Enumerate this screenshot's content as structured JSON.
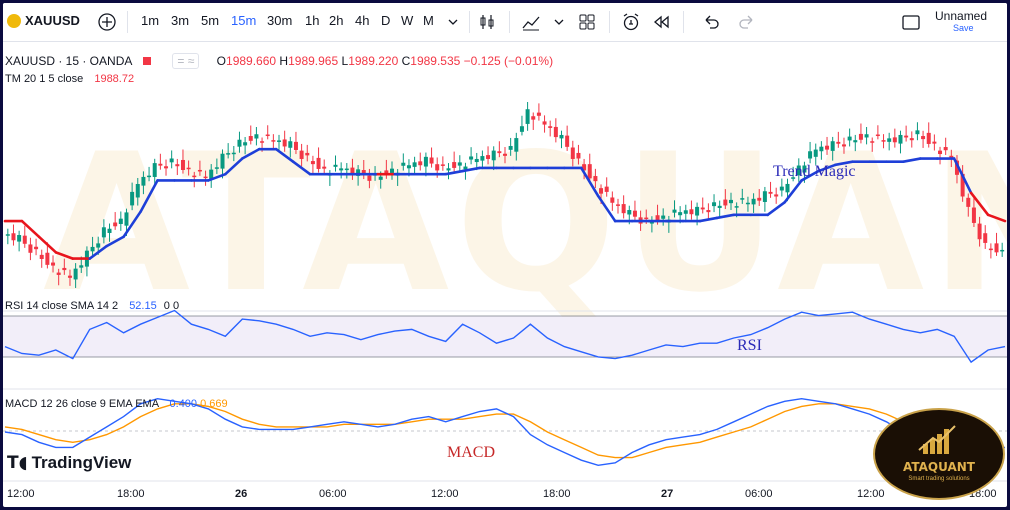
{
  "toolbar": {
    "symbol": "XAUUSD",
    "timeframes": [
      "1m",
      "3m",
      "5m",
      "15m",
      "30m",
      "1h",
      "2h",
      "4h",
      "D",
      "W",
      "M"
    ],
    "active_timeframe": "15m",
    "layout_name": "Unnamed",
    "save_label": "Save"
  },
  "legend": {
    "title": "XAUUSD · 15 · OANDA",
    "open_label": "O",
    "open": "1989.660",
    "high_label": "H",
    "high": "1989.965",
    "low_label": "L",
    "low": "1989.220",
    "close_label": "C",
    "close": "1989.535",
    "change": "−0.125 (−0.01%)",
    "tm_label": "TM 20 1 5 close",
    "tm_value": "1988.72",
    "rsi_label": "RSI 14 close SMA 14 2",
    "rsi_value": "52.15",
    "rsi_extra": "0 0",
    "macd_label": "MACD 12 26 close 9 EMA EMA",
    "macd_value": "0.400",
    "macd_signal": "0.669"
  },
  "annotations": {
    "trend_magic": "Trend Magic",
    "rsi": "RSI",
    "macd": "MACD"
  },
  "watermark": "ATAQUANT",
  "brand": {
    "tradingview": "TradingView",
    "logo_name": "ATAQUANT",
    "logo_tagline": "Smart trading solutions"
  },
  "time_axis": [
    "12:00",
    "18:00",
    "26",
    "06:00",
    "12:00",
    "18:00",
    "27",
    "06:00",
    "12:00",
    "18:00"
  ],
  "colors": {
    "up": "#089981",
    "down": "#f23645",
    "trend_up": "#1e3fd8",
    "trend_down": "#e8141c",
    "rsi": "#2962ff",
    "macd": "#2962ff",
    "signal": "#ff9800",
    "rsi_band": "#7e57c2"
  },
  "chart_data": {
    "type": "line",
    "price_series": [
      1988.2,
      1988.0,
      1987.6,
      1987.1,
      1986.8,
      1987.5,
      1988.3,
      1988.6,
      1989.8,
      1990.3,
      1990.5,
      1990.2,
      1990.0,
      1990.6,
      1991.1,
      1991.3,
      1991.2,
      1991.0,
      1990.6,
      1990.2,
      1990.3,
      1990.1,
      1990.0,
      1990.2,
      1990.4,
      1990.5,
      1990.3,
      1990.4,
      1990.6,
      1990.7,
      1990.9,
      1992.1,
      1991.7,
      1991.2,
      1990.5,
      1989.8,
      1989.2,
      1988.8,
      1988.6,
      1988.7,
      1988.9,
      1988.9,
      1989.1,
      1989.2,
      1989.2,
      1989.4,
      1989.6,
      1990.3,
      1990.9,
      1991.0,
      1991.2,
      1991.3,
      1991.2,
      1991.2,
      1991.4,
      1991.0,
      1990.6,
      1988.9,
      1987.8,
      1987.6
    ],
    "trend_magic": [
      1988.6,
      1988.6,
      1988.1,
      1987.6,
      1987.4,
      1987.4,
      1987.8,
      1988.1,
      1988.9,
      1989.9,
      1989.9,
      1989.9,
      1989.9,
      1990.1,
      1990.6,
      1990.9,
      1990.9,
      1990.5,
      1990.1,
      1990.1,
      1990.1,
      1990.1,
      1990.1,
      1990.1,
      1990.1,
      1990.1,
      1990.1,
      1990.2,
      1990.3,
      1990.3,
      1990.3,
      1990.3,
      1990.3,
      1990.3,
      1990.3,
      1989.4,
      1988.6,
      1988.6,
      1988.6,
      1988.6,
      1988.6,
      1988.6,
      1988.7,
      1988.8,
      1988.8,
      1988.8,
      1989.2,
      1989.9,
      1990.2,
      1990.4,
      1990.5,
      1990.5,
      1990.5,
      1990.5,
      1990.6,
      1990.6,
      1990.6,
      1989.5,
      1988.8,
      1988.6
    ],
    "rsi": [
      50,
      46,
      45,
      48,
      43,
      60,
      64,
      58,
      63,
      67,
      71,
      63,
      60,
      56,
      66,
      65,
      63,
      60,
      56,
      58,
      57,
      54,
      57,
      59,
      60,
      56,
      53,
      63,
      58,
      52,
      55,
      63,
      55,
      50,
      47,
      44,
      43,
      45,
      48,
      51,
      50,
      52,
      52,
      55,
      57,
      61,
      66,
      70,
      68,
      69,
      70,
      66,
      63,
      60,
      58,
      60,
      56,
      41,
      48,
      50
    ],
    "macd": [
      -0.3,
      -0.4,
      -0.7,
      -0.9,
      -0.9,
      -0.5,
      -0.1,
      0.3,
      0.8,
      1.0,
      0.9,
      0.8,
      0.6,
      0.2,
      -0.1,
      -0.2,
      -0.2,
      -0.2,
      -0.1,
      0.0,
      0.1,
      0.0,
      -0.1,
      0.0,
      0.2,
      0.3,
      0.1,
      0.3,
      0.5,
      0.6,
      0.3,
      -0.4,
      -0.8,
      -1.1,
      -1.4,
      -1.6,
      -1.5,
      -1.1,
      -0.8,
      -0.6,
      -0.5,
      -0.4,
      -0.2,
      0.1,
      0.4,
      0.7,
      0.9,
      1.0,
      0.9,
      0.8,
      0.6,
      0.4,
      0.1,
      -0.3,
      -0.7,
      -0.9,
      -1.0,
      -1.1,
      -1.0,
      -0.9
    ],
    "signal": [
      -0.1,
      -0.2,
      -0.4,
      -0.6,
      -0.7,
      -0.6,
      -0.4,
      -0.1,
      0.3,
      0.6,
      0.8,
      0.8,
      0.7,
      0.5,
      0.2,
      0.0,
      -0.1,
      -0.1,
      -0.1,
      -0.1,
      0.0,
      0.0,
      0.0,
      0.0,
      0.1,
      0.2,
      0.2,
      0.2,
      0.3,
      0.4,
      0.4,
      0.1,
      -0.3,
      -0.6,
      -0.9,
      -1.2,
      -1.3,
      -1.3,
      -1.1,
      -0.9,
      -0.8,
      -0.7,
      -0.5,
      -0.3,
      -0.1,
      0.2,
      0.5,
      0.7,
      0.8,
      0.8,
      0.7,
      0.6,
      0.4,
      0.1,
      -0.2,
      -0.5,
      -0.7,
      -0.9,
      -0.9,
      -0.9
    ]
  }
}
